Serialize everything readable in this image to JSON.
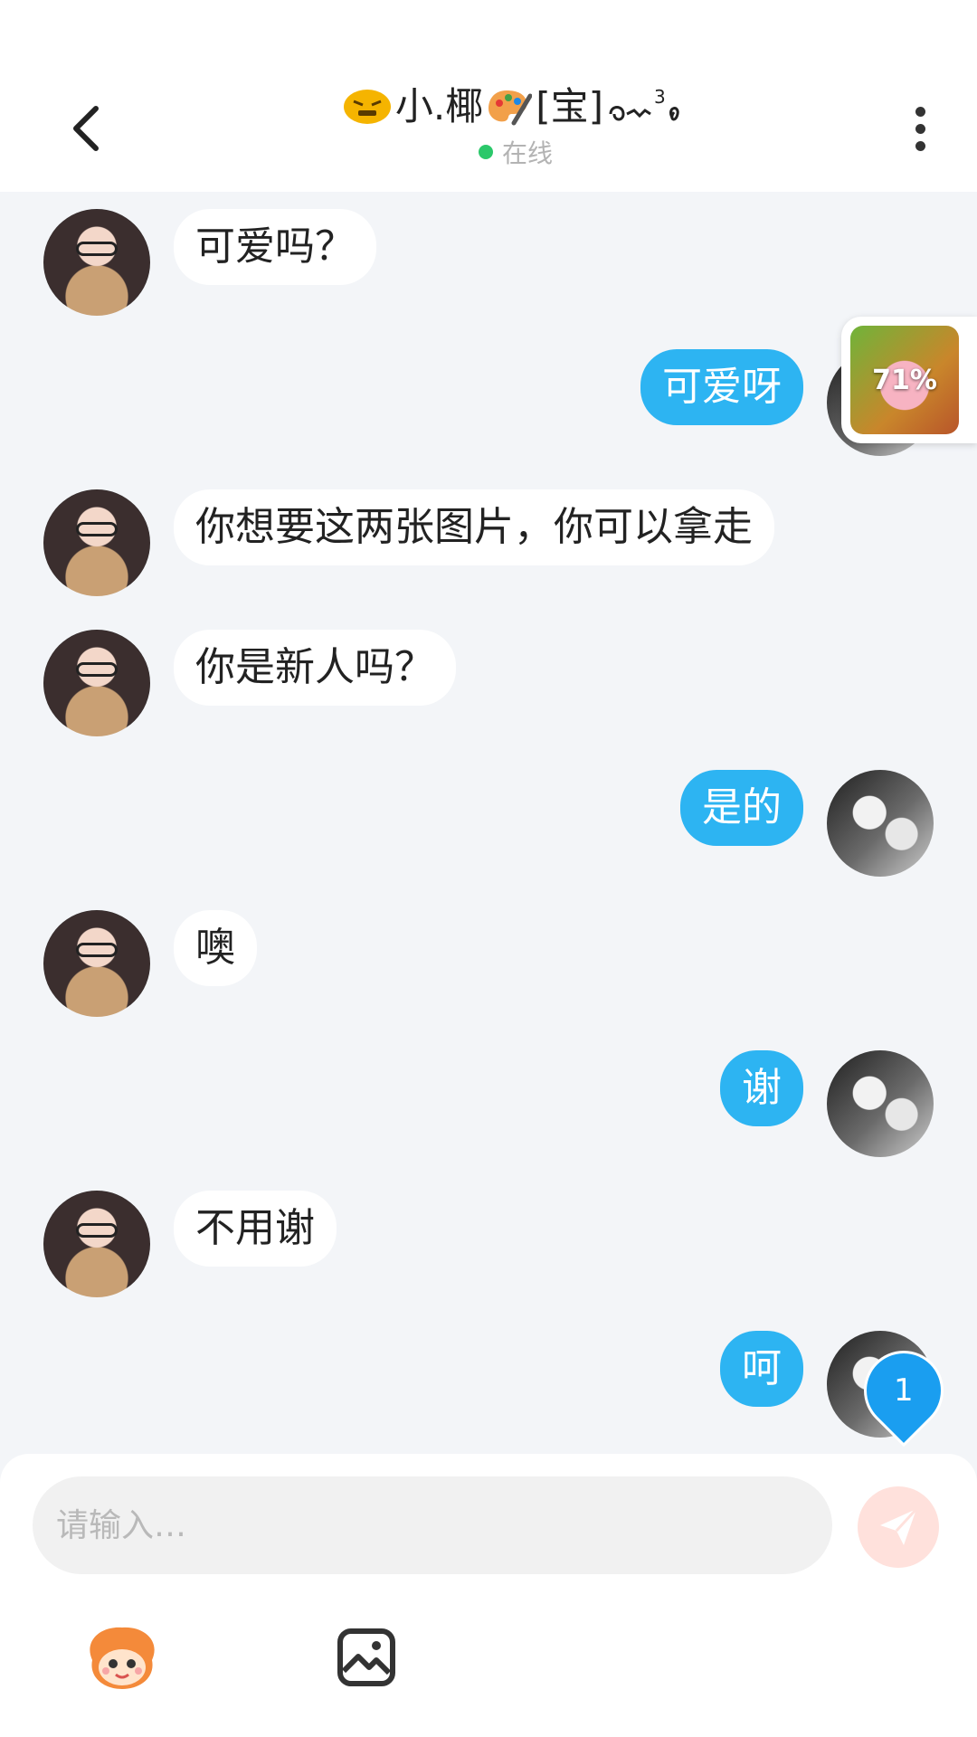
{
  "header": {
    "contact_name": "小.椰",
    "contact_tag": "[宝]",
    "status_text": "在线",
    "status_color": "#2bc86a"
  },
  "messages": [
    {
      "from": "other",
      "text": "可爱吗？"
    },
    {
      "from": "me",
      "text": "可爱呀"
    },
    {
      "from": "other",
      "text": "你想要这两张图片，你可以拿走"
    },
    {
      "from": "other",
      "text": "你是新人吗？"
    },
    {
      "from": "me",
      "text": "是的"
    },
    {
      "from": "other",
      "text": "噢"
    },
    {
      "from": "me",
      "text": "谢"
    },
    {
      "from": "other",
      "text": "不用谢"
    },
    {
      "from": "me",
      "text": "呵"
    }
  ],
  "game_widget": {
    "progress_label": "71%",
    "progress": 0.71
  },
  "unread_badge": {
    "count": "1"
  },
  "composer": {
    "placeholder": "请输入…"
  },
  "colors": {
    "my_bubble": "#2db4f2",
    "other_bubble": "#ffffff",
    "background": "#f3f5f8",
    "send_button": "#ffe1dc"
  },
  "icons": {
    "back": "chevron-left-icon",
    "more": "more-vertical-icon",
    "send": "paper-plane-icon",
    "mascot": "mascot-face-icon",
    "image": "image-icon"
  }
}
